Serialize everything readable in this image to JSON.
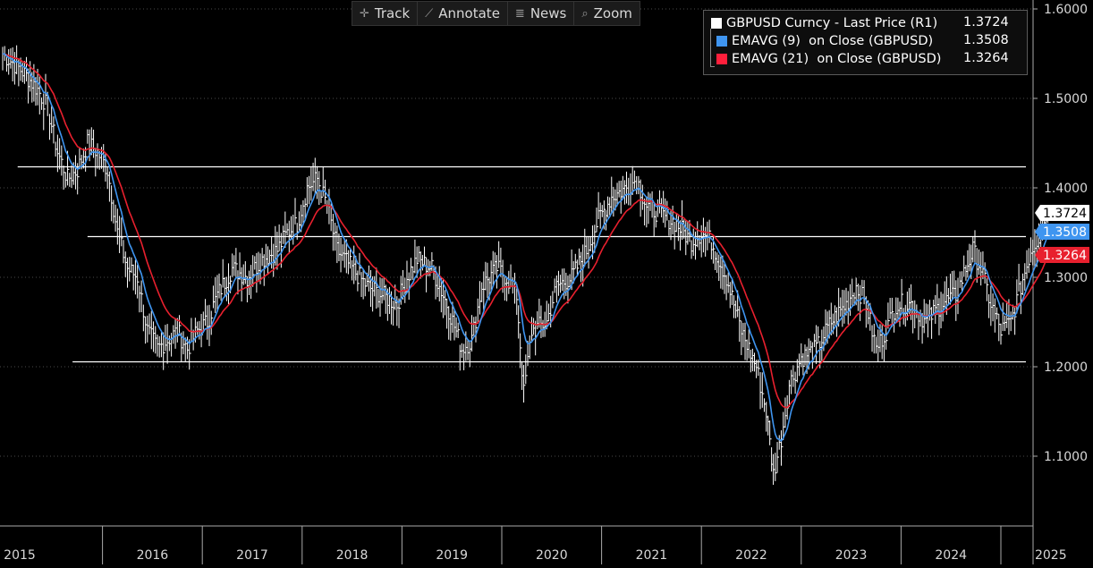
{
  "toolbar": {
    "items": [
      {
        "label": "Track",
        "icon": "crosshair-icon"
      },
      {
        "label": "Annotate",
        "icon": "pen-icon"
      },
      {
        "label": "News",
        "icon": "news-icon"
      },
      {
        "label": "Zoom",
        "icon": "zoom-icon"
      }
    ]
  },
  "legend": {
    "entries": [
      {
        "name": "GBPUSD Curncy - Last Price (R1)",
        "value": "1.3724",
        "color": "#ffffff"
      },
      {
        "name": "EMAVG (9)  on Close (GBPUSD)",
        "value": "1.3508",
        "color": "#3f95f0"
      },
      {
        "name": "EMAVG (21)  on Close (GBPUSD)",
        "value": "1.3264",
        "color": "#ff1f3b"
      }
    ]
  },
  "colors": {
    "background": "#000000",
    "price": "#ffffff",
    "ema9": "#3f95f0",
    "ema21": "#e8202e",
    "grid": "#4a4a4a",
    "axis": "#aaaaaa"
  },
  "chart_data": {
    "type": "line",
    "title": "",
    "xlabel": "",
    "ylabel": "",
    "x_tick_labels": [
      "2015",
      "2016",
      "2017",
      "2018",
      "2019",
      "2020",
      "2021",
      "2022",
      "2023",
      "2024",
      "2025"
    ],
    "y_tick_labels": [
      "1.1000",
      "1.2000",
      "1.3000",
      "1.4000",
      "1.5000",
      "1.6000"
    ],
    "ylim": [
      1.03,
      1.62
    ],
    "xlim": [
      2015.0,
      2025.95
    ],
    "y_axis_side": "right",
    "grid": "horizontal dotted",
    "legend_position": "top-right",
    "price_series": {
      "name": "GBPUSD Curncy - Last Price (R1)",
      "points": [
        [
          2015.0,
          1.55
        ],
        [
          2015.1,
          1.54
        ],
        [
          2015.2,
          1.53
        ],
        [
          2015.35,
          1.51
        ],
        [
          2015.45,
          1.49
        ],
        [
          2015.55,
          1.44
        ],
        [
          2015.65,
          1.41
        ],
        [
          2015.75,
          1.42
        ],
        [
          2015.85,
          1.45
        ],
        [
          2015.95,
          1.44
        ],
        [
          2016.05,
          1.42
        ],
        [
          2016.15,
          1.35
        ],
        [
          2016.25,
          1.31
        ],
        [
          2016.35,
          1.3
        ],
        [
          2016.45,
          1.24
        ],
        [
          2016.55,
          1.22
        ],
        [
          2016.65,
          1.23
        ],
        [
          2016.75,
          1.24
        ],
        [
          2016.85,
          1.22
        ],
        [
          2016.95,
          1.24
        ],
        [
          2017.05,
          1.25
        ],
        [
          2017.15,
          1.28
        ],
        [
          2017.3,
          1.31
        ],
        [
          2017.45,
          1.3
        ],
        [
          2017.6,
          1.32
        ],
        [
          2017.75,
          1.33
        ],
        [
          2017.85,
          1.35
        ],
        [
          2017.95,
          1.36
        ],
        [
          2018.05,
          1.4
        ],
        [
          2018.15,
          1.41
        ],
        [
          2018.25,
          1.38
        ],
        [
          2018.35,
          1.33
        ],
        [
          2018.5,
          1.31
        ],
        [
          2018.65,
          1.29
        ],
        [
          2018.8,
          1.28
        ],
        [
          2018.95,
          1.27
        ],
        [
          2019.05,
          1.3
        ],
        [
          2019.15,
          1.32
        ],
        [
          2019.3,
          1.31
        ],
        [
          2019.45,
          1.27
        ],
        [
          2019.6,
          1.22
        ],
        [
          2019.7,
          1.23
        ],
        [
          2019.8,
          1.29
        ],
        [
          2019.95,
          1.31
        ],
        [
          2020.05,
          1.3
        ],
        [
          2020.15,
          1.28
        ],
        [
          2020.22,
          1.17
        ],
        [
          2020.3,
          1.24
        ],
        [
          2020.45,
          1.25
        ],
        [
          2020.55,
          1.29
        ],
        [
          2020.7,
          1.3
        ],
        [
          2020.85,
          1.33
        ],
        [
          2020.95,
          1.36
        ],
        [
          2021.1,
          1.39
        ],
        [
          2021.25,
          1.4
        ],
        [
          2021.35,
          1.41
        ],
        [
          2021.45,
          1.38
        ],
        [
          2021.6,
          1.37
        ],
        [
          2021.75,
          1.36
        ],
        [
          2021.9,
          1.34
        ],
        [
          2022.0,
          1.35
        ],
        [
          2022.1,
          1.34
        ],
        [
          2022.25,
          1.3
        ],
        [
          2022.4,
          1.24
        ],
        [
          2022.55,
          1.2
        ],
        [
          2022.65,
          1.15
        ],
        [
          2022.72,
          1.08
        ],
        [
          2022.8,
          1.12
        ],
        [
          2022.88,
          1.18
        ],
        [
          2023.0,
          1.21
        ],
        [
          2023.15,
          1.22
        ],
        [
          2023.3,
          1.25
        ],
        [
          2023.45,
          1.27
        ],
        [
          2023.55,
          1.29
        ],
        [
          2023.65,
          1.27
        ],
        [
          2023.75,
          1.22
        ],
        [
          2023.85,
          1.24
        ],
        [
          2023.95,
          1.27
        ],
        [
          2024.1,
          1.27
        ],
        [
          2024.25,
          1.25
        ],
        [
          2024.4,
          1.27
        ],
        [
          2024.55,
          1.28
        ],
        [
          2024.65,
          1.31
        ],
        [
          2024.72,
          1.33
        ],
        [
          2024.8,
          1.31
        ],
        [
          2024.9,
          1.27
        ],
        [
          2025.0,
          1.24
        ],
        [
          2025.1,
          1.25
        ],
        [
          2025.2,
          1.29
        ],
        [
          2025.3,
          1.33
        ],
        [
          2025.4,
          1.35
        ],
        [
          2025.47,
          1.3724
        ]
      ]
    },
    "series": [
      {
        "name": "EMAVG (9)  on Close (GBPUSD)",
        "last": 1.3508
      },
      {
        "name": "EMAVG (21)  on Close (GBPUSD)",
        "last": 1.3264
      }
    ],
    "horizontal_lines": [
      {
        "y": 1.4235,
        "x_start": 2015.15
      },
      {
        "y": 1.3455,
        "x_start": 2015.85
      },
      {
        "y": 1.2055,
        "x_start": 2015.7
      }
    ],
    "last_value_labels": [
      {
        "value": "1.3724",
        "y": 1.3724,
        "color": "#ffffff",
        "text_color": "#000000"
      },
      {
        "value": "1.3508",
        "y": 1.3508,
        "color": "#3f95f0",
        "text_color": "#ffffff"
      },
      {
        "value": "1.3264",
        "y": 1.3264,
        "color": "#e8202e",
        "text_color": "#ffffff"
      }
    ]
  }
}
